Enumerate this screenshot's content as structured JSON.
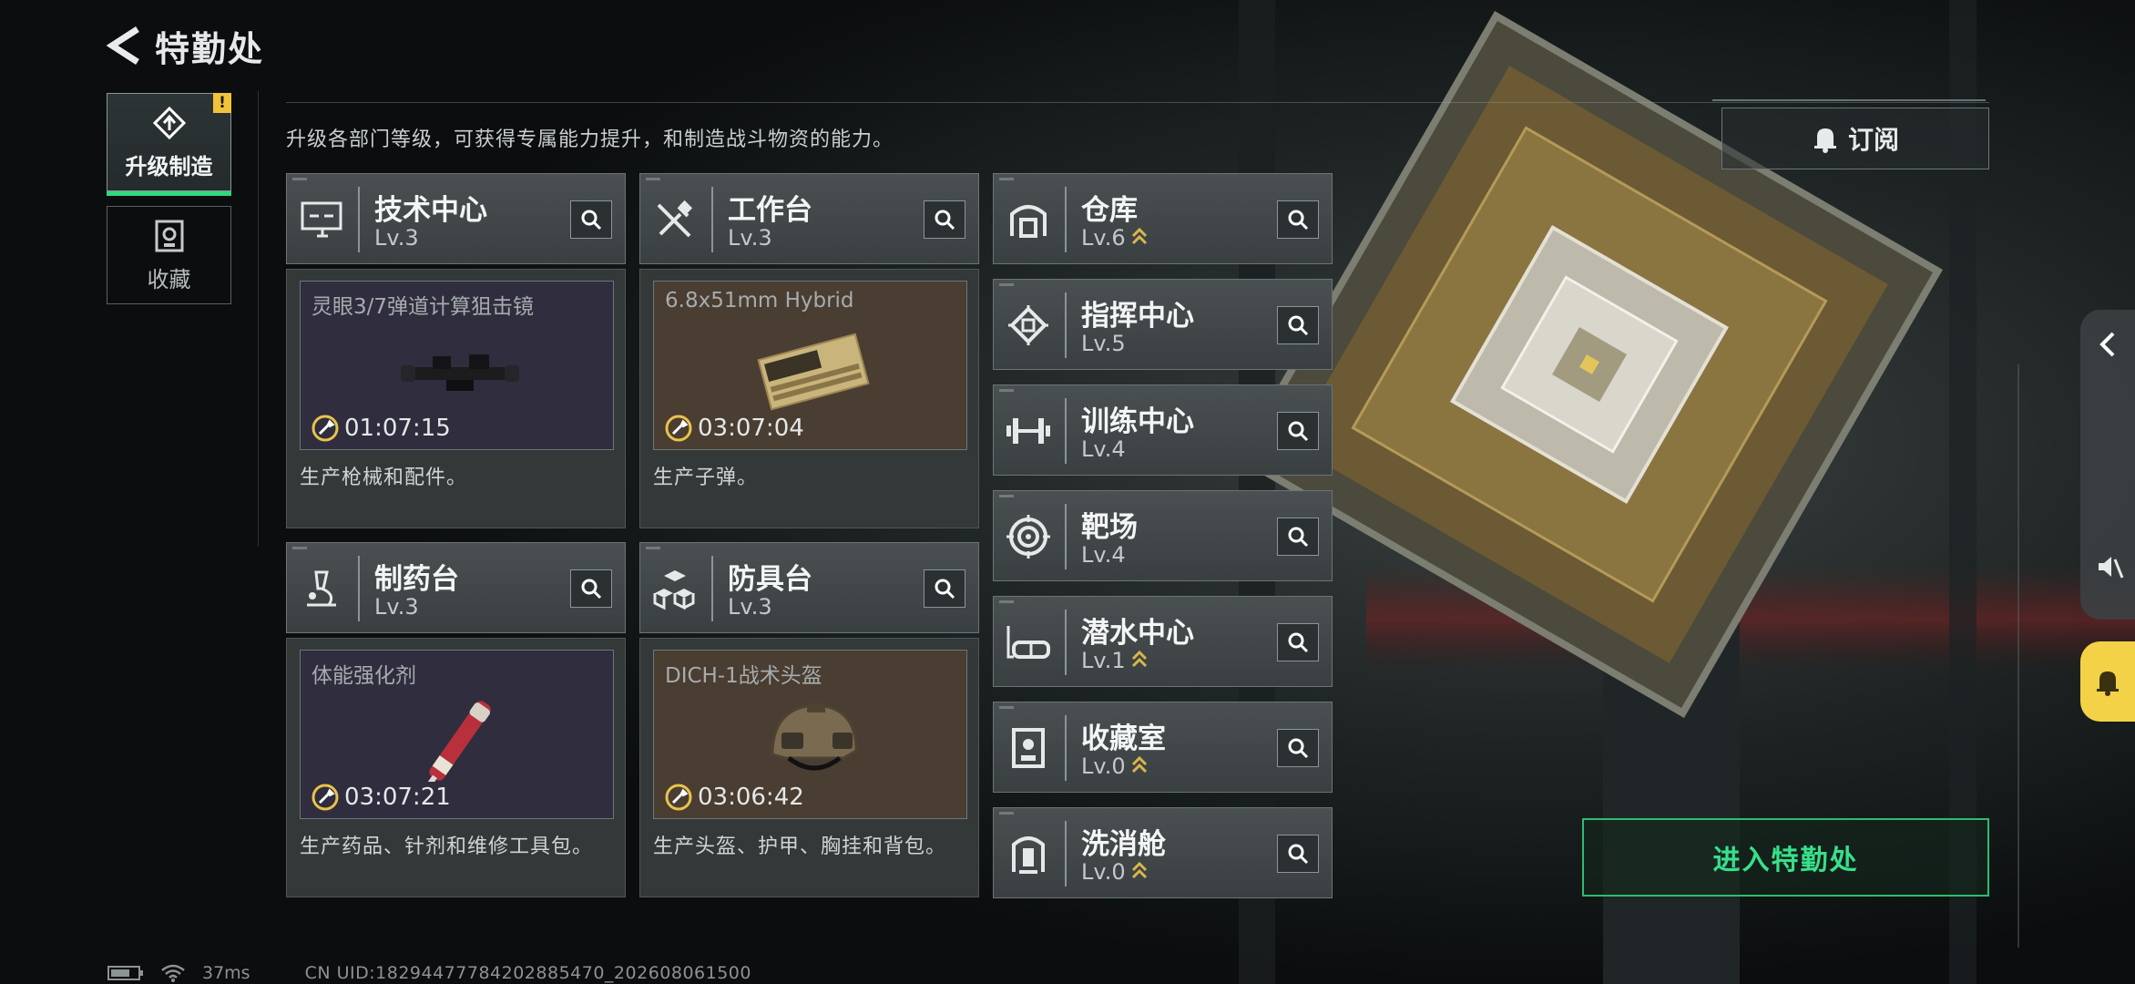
{
  "header": {
    "title": "特勤处"
  },
  "nav": {
    "tabs": [
      {
        "label": "升级制造",
        "badge": "!"
      },
      {
        "label": "收藏"
      }
    ]
  },
  "description": "升级各部门等级，可获得专属能力提升，和制造战斗物资的能力。",
  "production_facilities": [
    {
      "name": "技术中心",
      "level": "Lv.3",
      "item": "灵眼3/7弹道计算狙击镜",
      "timer": "01:07:15",
      "desc": "生产枪械和配件。",
      "slot_color": "#2f2d3e"
    },
    {
      "name": "工作台",
      "level": "Lv.3",
      "item": "6.8x51mm Hybrid",
      "timer": "03:07:04",
      "desc": "生产子弹。",
      "slot_color": "#4a3d31"
    },
    {
      "name": "制药台",
      "level": "Lv.3",
      "item": "体能强化剂",
      "timer": "03:07:21",
      "desc": "生产药品、针剂和维修工具包。",
      "slot_color": "#2f2d3e"
    },
    {
      "name": "防具台",
      "level": "Lv.3",
      "item": "DICH-1战术头盔",
      "timer": "03:06:42",
      "desc": "生产头盔、护甲、胸挂和背包。",
      "slot_color": "#4a3d31"
    }
  ],
  "other_facilities": [
    {
      "name": "仓库",
      "level": "Lv.6",
      "upgradable": true
    },
    {
      "name": "指挥中心",
      "level": "Lv.5",
      "upgradable": false
    },
    {
      "name": "训练中心",
      "level": "Lv.4",
      "upgradable": false
    },
    {
      "name": "靶场",
      "level": "Lv.4",
      "upgradable": false
    },
    {
      "name": "潜水中心",
      "level": "Lv.1",
      "upgradable": true
    },
    {
      "name": "收藏室",
      "level": "Lv.0",
      "upgradable": true
    },
    {
      "name": "洗消舱",
      "level": "Lv.0",
      "upgradable": true
    }
  ],
  "subscribe": {
    "label": "订阅"
  },
  "enter": {
    "label": "进入特勤处"
  },
  "status": {
    "ping": "37ms",
    "uid": "CN UID:18294477784202885470_202608061500"
  },
  "colors": {
    "accent_green": "#2fd97d",
    "warning_yellow": "#f2c23a",
    "upgrade_gold": "#d9b54a"
  }
}
